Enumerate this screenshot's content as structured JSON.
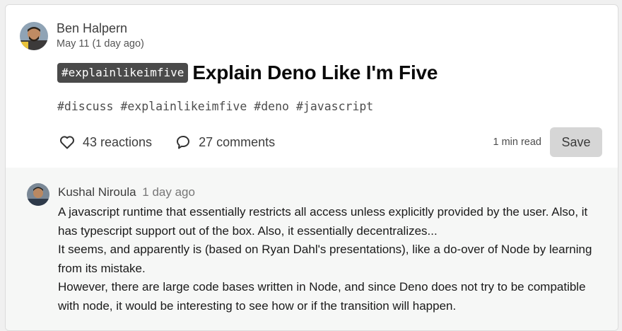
{
  "post": {
    "author": {
      "name": "Ben Halpern",
      "date": "May 11 (1 day ago)"
    },
    "title_tag": "#explainlikeimfive",
    "title": "Explain Deno Like I'm Five",
    "tags": [
      "#discuss",
      "#explainlikeimfive",
      "#deno",
      "#javascript"
    ],
    "reactions_label": "43 reactions",
    "comments_label": "27 comments",
    "read_time": "1 min read",
    "save_label": "Save"
  },
  "comment": {
    "author": "Kushal Niroula",
    "date": "1 day ago",
    "paragraphs": [
      "A javascript runtime that essentially restricts all access unless explicitly provided by the user. Also, it has typescript support out of the box. Also, it essentially decentralizes...",
      "It seems, and apparently is (based on Ryan Dahl's presentations), like a do-over of Node by learning from its mistake.",
      "However, there are large code bases written in Node, and since Deno does not try to be compatible with node, it would be interesting to see how or if the transition will happen."
    ]
  },
  "icons": {
    "reactions": "heart-icon",
    "comments": "comment-bubble-icon"
  },
  "colors": {
    "tag_pill_bg": "#4a4a4a",
    "save_button_bg": "#d6d6d6",
    "comment_area_bg": "#f6f7f6"
  }
}
